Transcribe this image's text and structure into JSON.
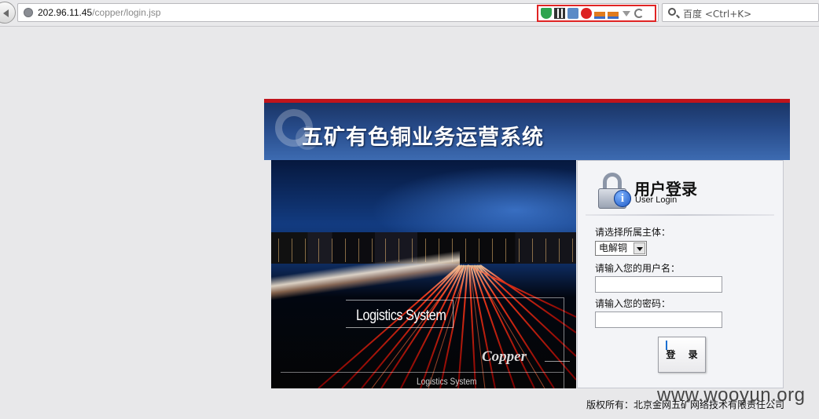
{
  "browser": {
    "url_host": "202.96.11.45",
    "url_path": "/copper/login.jsp",
    "search_placeholder": "百度 <Ctrl+K>",
    "addon_icons": [
      "shield-icon",
      "qr-code-icon",
      "translate-icon",
      "virus-scan-icon",
      "java-icon",
      "java-icon",
      "dropdown-arrow-icon",
      "reload-icon"
    ]
  },
  "app": {
    "system_title": "五矿有色铜业务运营系统",
    "banner_texts": {
      "logistics_main": "Logistics System",
      "copper": "Copper",
      "logistics_small": "Logistics System"
    },
    "login": {
      "title": "用户登录",
      "subtitle": "User Login",
      "entity_label": "请选择所属主体：",
      "entity_selected": "电解铜",
      "username_label": "请输入您的用户名：",
      "username_value": "",
      "password_label": "请输入您的密码：",
      "password_value": "",
      "submit_label": "登 录"
    },
    "copyright": "版权所有：北京金网五矿网络技术有限责任公司"
  },
  "watermark": "www.wooyun.org",
  "colors": {
    "header_red_line": "#c0141b",
    "header_blue": "#274b8a",
    "highlight_box": "#e02424"
  }
}
